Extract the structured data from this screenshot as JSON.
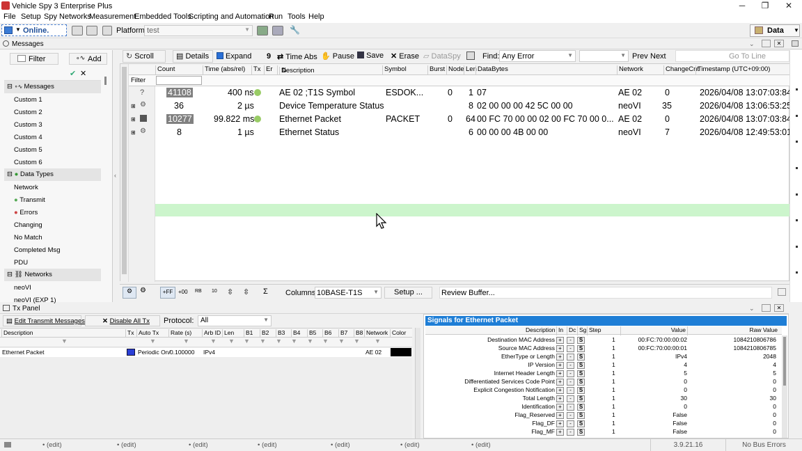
{
  "window": {
    "title": "Vehicle Spy 3 Enterprise Plus",
    "minimize": "─",
    "restore": "❐",
    "close": "✕"
  },
  "menu": [
    "File",
    "Setup",
    "Spy Networks",
    "Measurement",
    "Embedded Tools",
    "Scripting and Automation",
    "Run",
    "Tools",
    "Help"
  ],
  "toolbar": {
    "online_label": "Online.",
    "platform_label": "Platform:",
    "platform_value": "test",
    "data_label": "Data"
  },
  "messages_panel": {
    "title": "Messages"
  },
  "left_tree": {
    "filter_label": "Filter",
    "add_label": "Add",
    "items": [
      {
        "label": "Messages",
        "kind": "group"
      },
      {
        "label": "Custom 1"
      },
      {
        "label": "Custom 2"
      },
      {
        "label": "Custom 3"
      },
      {
        "label": "Custom 4"
      },
      {
        "label": "Custom 5"
      },
      {
        "label": "Custom 6"
      },
      {
        "label": "Data Types",
        "kind": "group"
      },
      {
        "label": "Network"
      },
      {
        "label": "Transmit"
      },
      {
        "label": "Errors"
      },
      {
        "label": "Changing"
      },
      {
        "label": "No Match"
      },
      {
        "label": "Completed Msg"
      },
      {
        "label": "PDU"
      },
      {
        "label": "Networks",
        "kind": "group"
      },
      {
        "label": "neoVI"
      },
      {
        "label": "neoVI (EXP 1)"
      }
    ]
  },
  "msg_toolbar": {
    "scroll": "Scroll",
    "details": "Details",
    "expand": "Expand",
    "time_abs": "Time Abs",
    "pause": "Pause",
    "save": "Save",
    "erase": "Erase",
    "dataspy": "DataSpy",
    "find_label": "Find:",
    "find_value": "Any Error",
    "prev": "Prev",
    "next": "Next",
    "goto": "Go To Line"
  },
  "grid": {
    "filter_label": "Filter",
    "headers": [
      "Count",
      "Time (abs/rel)",
      "Tx",
      "Er",
      "Description",
      "Symbol",
      "Burst",
      "Node",
      "Len",
      "DataBytes",
      "Network",
      "ChangeCnt",
      "Timestamp (UTC+09:00)"
    ],
    "rows": [
      {
        "count": "41108",
        "time": "400 ns",
        "desc": "AE 02 ;T1S Symbol",
        "symbol": "ESDOK...",
        "burst": "0",
        "len": "1",
        "data": "07",
        "network": "AE 02",
        "changecnt": "0",
        "timestamp": "2026/04/08 13:07:03:84"
      },
      {
        "count": "36",
        "time": "2 µs",
        "desc": "Device Temperature Status",
        "symbol": "",
        "burst": "",
        "len": "8",
        "data": "02 00 00 00 42 5C 00 00",
        "network": "neoVI",
        "changecnt": "35",
        "timestamp": "2026/04/08 13:06:53:25"
      },
      {
        "count": "10277",
        "time": "99.822 ms",
        "desc": "Ethernet Packet",
        "symbol": "PACKET",
        "burst": "0",
        "len": "64",
        "data": "00 FC 70 00 00 02 00 FC 70 00 0...",
        "network": "AE 02",
        "changecnt": "0",
        "timestamp": "2026/04/08 13:07:03:84"
      },
      {
        "count": "8",
        "time": "1 µs",
        "desc": "Ethernet Status",
        "symbol": "",
        "burst": "",
        "len": "6",
        "data": "00 00 00 4B 00 00",
        "network": "neoVI",
        "changecnt": "7",
        "timestamp": "2026/04/08 12:49:53:01"
      }
    ]
  },
  "bottom_toolbar": {
    "columns_label": "Columns",
    "columns_value": "10BASE-T1S",
    "setup": "Setup ...",
    "review": "Review Buffer...",
    "icons": [
      "+FF",
      "+00",
      "RB",
      "10"
    ]
  },
  "tx_panel": {
    "title": "Tx Panel",
    "edit_btn": "Edit Transmit Messages",
    "disable_btn": "Disable All Tx",
    "protocol_label": "Protocol:",
    "protocol_value": "All",
    "headers": [
      "Description",
      "Tx",
      "Auto Tx",
      "Rate (s)",
      "Arb ID",
      "Len",
      "B1",
      "B2",
      "B3",
      "B4",
      "B5",
      "B6",
      "B7",
      "B8",
      "Network",
      "Color"
    ],
    "row": {
      "desc": "Ethernet Packet",
      "autotx": "Periodic On/",
      "rate": "0.100000",
      "arbid": "IPv4",
      "network": "AE 02",
      "color": "#000000"
    }
  },
  "signals": {
    "title": "Signals for Ethernet Packet",
    "headers": {
      "desc": "Description",
      "in": "In",
      "dc": "Dc",
      "sg": "Sg",
      "step": "Step",
      "value": "Value",
      "raw": "Raw Value"
    },
    "rows": [
      {
        "desc": "Destination MAC Address",
        "step": "1",
        "value": "00:FC:70:00:00:02",
        "raw": "1084210806786"
      },
      {
        "desc": "Source MAC Address",
        "step": "1",
        "value": "00:FC:70:00:00:01",
        "raw": "1084210806785"
      },
      {
        "desc": "EtherType or Length",
        "step": "1",
        "value": "IPv4",
        "raw": "2048"
      },
      {
        "desc": "IP Version",
        "step": "1",
        "value": "4",
        "raw": "4"
      },
      {
        "desc": "Internet Header Length",
        "step": "1",
        "value": "5",
        "raw": "5"
      },
      {
        "desc": "Differentiated Services Code Point",
        "step": "1",
        "value": "0",
        "raw": "0"
      },
      {
        "desc": "Explicit Congestion Notification",
        "step": "1",
        "value": "0",
        "raw": "0"
      },
      {
        "desc": "Total Length",
        "step": "1",
        "value": "30",
        "raw": "30"
      },
      {
        "desc": "Identification",
        "step": "1",
        "value": "0",
        "raw": "0"
      },
      {
        "desc": "Flag_Reserved",
        "step": "1",
        "value": "False",
        "raw": "0"
      },
      {
        "desc": "Flag_DF",
        "step": "1",
        "value": "False",
        "raw": "0"
      },
      {
        "desc": "Flag_MF",
        "step": "1",
        "value": "False",
        "raw": "0"
      }
    ]
  },
  "statusbar": {
    "edit": "• (edit)",
    "version": "3.9.21.16",
    "bus": "No Bus Errors"
  },
  "colors": {
    "accent": "#0078d7",
    "selected_row": "#ccf5cc",
    "sig_header": "#1e7ed6",
    "count_highlight": "#808080"
  }
}
